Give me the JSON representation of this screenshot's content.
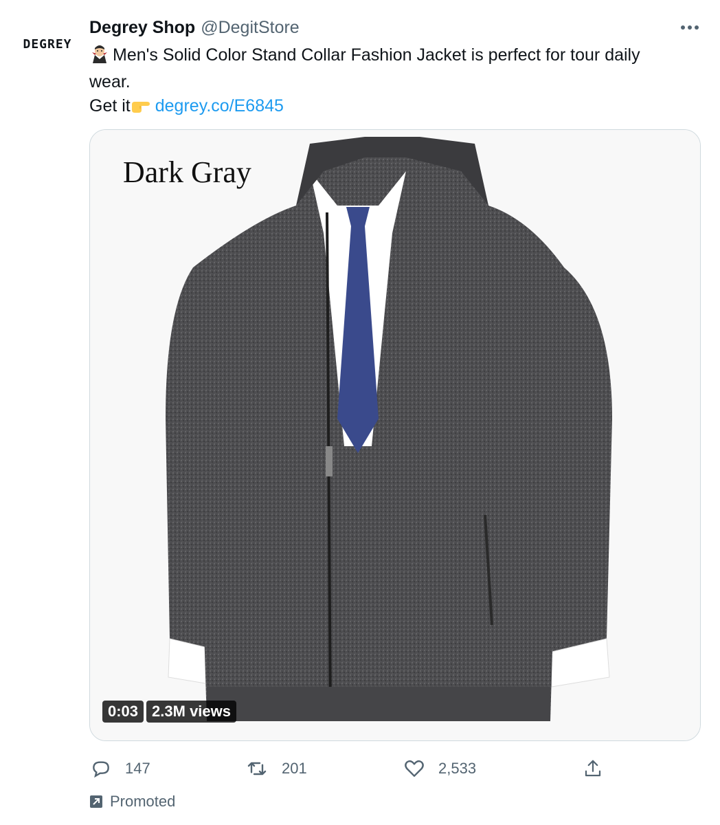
{
  "author": {
    "avatar_text": "DEGREY",
    "display_name": "Degrey Shop",
    "handle": "@DegitStore"
  },
  "tweet": {
    "line1_emoji": "vampire-icon",
    "line1_text": "Men's Solid Color Stand Collar Fashion Jacket is perfect for tour daily",
    "line2_text": "wear.",
    "line3_prefix": "Get it",
    "line3_emoji": "pointing-hand-icon",
    "link_text": "degrey.co/E6845"
  },
  "media": {
    "caption": "Dark Gray",
    "duration": "0:03",
    "views": "2.3M views"
  },
  "actions": {
    "reply_count": "147",
    "retweet_count": "201",
    "like_count": "2,533"
  },
  "promoted_label": "Promoted",
  "colors": {
    "link": "#1d9bf0",
    "secondary_text": "#536471",
    "jacket": "#4a4a4c",
    "tie": "#3a4a8c"
  }
}
